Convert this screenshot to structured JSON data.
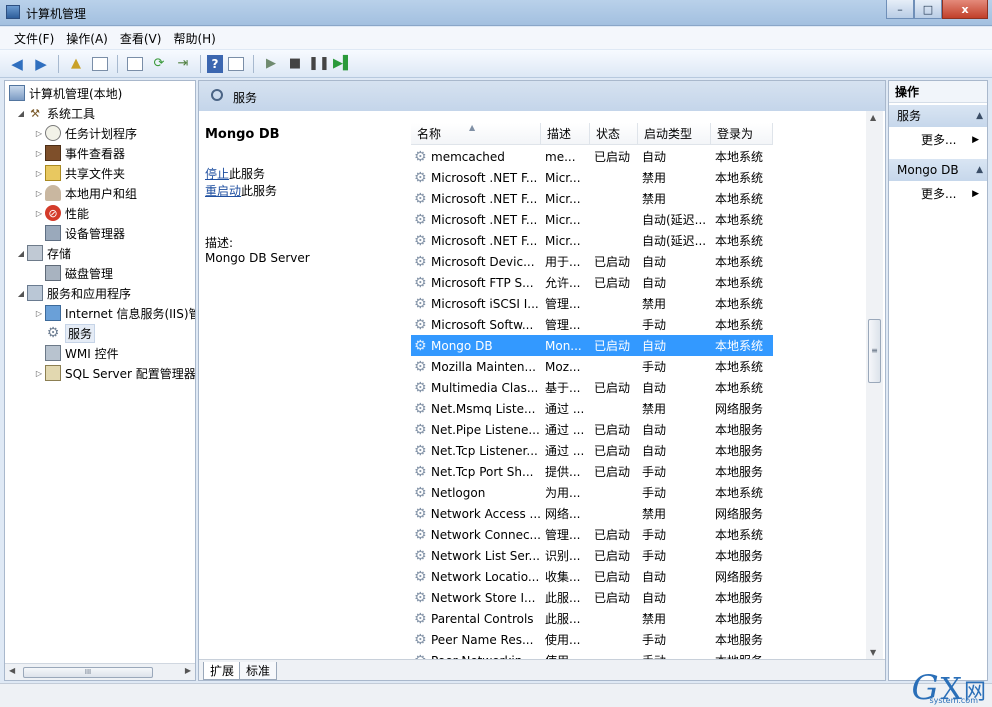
{
  "window": {
    "title": "计算机管理",
    "buttons": {
      "minimize": "–",
      "maximize": "□",
      "close": "x"
    }
  },
  "menu": [
    "文件(F)",
    "操作(A)",
    "查看(V)",
    "帮助(H)"
  ],
  "tree": {
    "root": "计算机管理(本地)",
    "items": [
      {
        "label": "系统工具",
        "level": 1,
        "icon": "tools-icon"
      },
      {
        "label": "任务计划程序",
        "level": 2,
        "icon": "clock-icon"
      },
      {
        "label": "事件查看器",
        "level": 2,
        "icon": "event-log-icon"
      },
      {
        "label": "共享文件夹",
        "level": 2,
        "icon": "shared-folder-icon"
      },
      {
        "label": "本地用户和组",
        "level": 2,
        "icon": "users-icon"
      },
      {
        "label": "性能",
        "level": 2,
        "icon": "performance-icon"
      },
      {
        "label": "设备管理器",
        "level": 2,
        "icon": "device-manager-icon"
      },
      {
        "label": "存储",
        "level": 1,
        "icon": "storage-icon"
      },
      {
        "label": "磁盘管理",
        "level": 2,
        "icon": "disk-icon"
      },
      {
        "label": "服务和应用程序",
        "level": 1,
        "icon": "services-apps-icon"
      },
      {
        "label": "Internet 信息服务(IIS)管",
        "level": 2,
        "icon": "iis-icon"
      },
      {
        "label": "服务",
        "level": 2,
        "icon": "gear-icon"
      },
      {
        "label": "WMI 控件",
        "level": 2,
        "icon": "wmi-icon"
      },
      {
        "label": "SQL Server 配置管理器",
        "level": 2,
        "icon": "sql-icon"
      }
    ],
    "scroll_thumb": "III"
  },
  "center": {
    "header": "服务",
    "selected_service": "Mongo DB",
    "stop_link": "停止",
    "stop_suffix": "此服务",
    "restart_link": "重启动",
    "restart_suffix": "此服务",
    "desc_label": "描述:",
    "desc_text": "Mongo DB Server",
    "columns": [
      "名称",
      "描述",
      "状态",
      "启动类型",
      "登录为"
    ],
    "rows": [
      {
        "name": "memcached",
        "desc": "me...",
        "status": "已启动",
        "startup": "自动",
        "logon": "本地系统"
      },
      {
        "name": "Microsoft .NET F...",
        "desc": "Micr...",
        "status": "",
        "startup": "禁用",
        "logon": "本地系统"
      },
      {
        "name": "Microsoft .NET F...",
        "desc": "Micr...",
        "status": "",
        "startup": "禁用",
        "logon": "本地系统"
      },
      {
        "name": "Microsoft .NET F...",
        "desc": "Micr...",
        "status": "",
        "startup": "自动(延迟...",
        "logon": "本地系统"
      },
      {
        "name": "Microsoft .NET F...",
        "desc": "Micr...",
        "status": "",
        "startup": "自动(延迟...",
        "logon": "本地系统"
      },
      {
        "name": "Microsoft Devic...",
        "desc": "用于...",
        "status": "已启动",
        "startup": "自动",
        "logon": "本地系统"
      },
      {
        "name": "Microsoft FTP S...",
        "desc": "允许...",
        "status": "已启动",
        "startup": "自动",
        "logon": "本地系统"
      },
      {
        "name": "Microsoft iSCSI I...",
        "desc": "管理...",
        "status": "",
        "startup": "禁用",
        "logon": "本地系统"
      },
      {
        "name": "Microsoft Softw...",
        "desc": "管理...",
        "status": "",
        "startup": "手动",
        "logon": "本地系统"
      },
      {
        "name": "Mongo DB",
        "desc": "Mon...",
        "status": "已启动",
        "startup": "自动",
        "logon": "本地系统",
        "selected": true
      },
      {
        "name": "Mozilla Mainten...",
        "desc": "Moz...",
        "status": "",
        "startup": "手动",
        "logon": "本地系统"
      },
      {
        "name": "Multimedia Clas...",
        "desc": "基于...",
        "status": "已启动",
        "startup": "自动",
        "logon": "本地系统"
      },
      {
        "name": "Net.Msmq Liste...",
        "desc": "通过 ...",
        "status": "",
        "startup": "禁用",
        "logon": "网络服务"
      },
      {
        "name": "Net.Pipe Listene...",
        "desc": "通过 ...",
        "status": "已启动",
        "startup": "自动",
        "logon": "本地服务"
      },
      {
        "name": "Net.Tcp Listener...",
        "desc": "通过 ...",
        "status": "已启动",
        "startup": "自动",
        "logon": "本地服务"
      },
      {
        "name": "Net.Tcp Port Sh...",
        "desc": "提供...",
        "status": "已启动",
        "startup": "手动",
        "logon": "本地服务"
      },
      {
        "name": "Netlogon",
        "desc": "为用...",
        "status": "",
        "startup": "手动",
        "logon": "本地系统"
      },
      {
        "name": "Network Access ...",
        "desc": "网络...",
        "status": "",
        "startup": "禁用",
        "logon": "网络服务"
      },
      {
        "name": "Network Connec...",
        "desc": "管理...",
        "status": "已启动",
        "startup": "手动",
        "logon": "本地系统"
      },
      {
        "name": "Network List Ser...",
        "desc": "识别...",
        "status": "已启动",
        "startup": "手动",
        "logon": "本地服务"
      },
      {
        "name": "Network Locatio...",
        "desc": "收集...",
        "status": "已启动",
        "startup": "自动",
        "logon": "网络服务"
      },
      {
        "name": "Network Store I...",
        "desc": "此服...",
        "status": "已启动",
        "startup": "自动",
        "logon": "本地服务"
      },
      {
        "name": "Parental Controls",
        "desc": "此服...",
        "status": "",
        "startup": "禁用",
        "logon": "本地服务"
      },
      {
        "name": "Peer Name Res...",
        "desc": "使用...",
        "status": "",
        "startup": "手动",
        "logon": "本地服务"
      },
      {
        "name": "Peer Networkin...",
        "desc": "使用...",
        "status": "",
        "startup": "手动",
        "logon": "本地服务"
      }
    ],
    "scroll_thumb": "≡",
    "tabs": [
      "扩展",
      "标准"
    ]
  },
  "actions": {
    "title": "操作",
    "sections": [
      {
        "label": "服务",
        "more": "更多..."
      },
      {
        "label": "Mongo DB",
        "more": "更多..."
      }
    ]
  },
  "watermark": {
    "g": "G",
    "x": "X",
    "wang": "网",
    "sub": "system.com"
  },
  "colors": {
    "selection": "#3399ff",
    "link": "#1f4fa0"
  }
}
